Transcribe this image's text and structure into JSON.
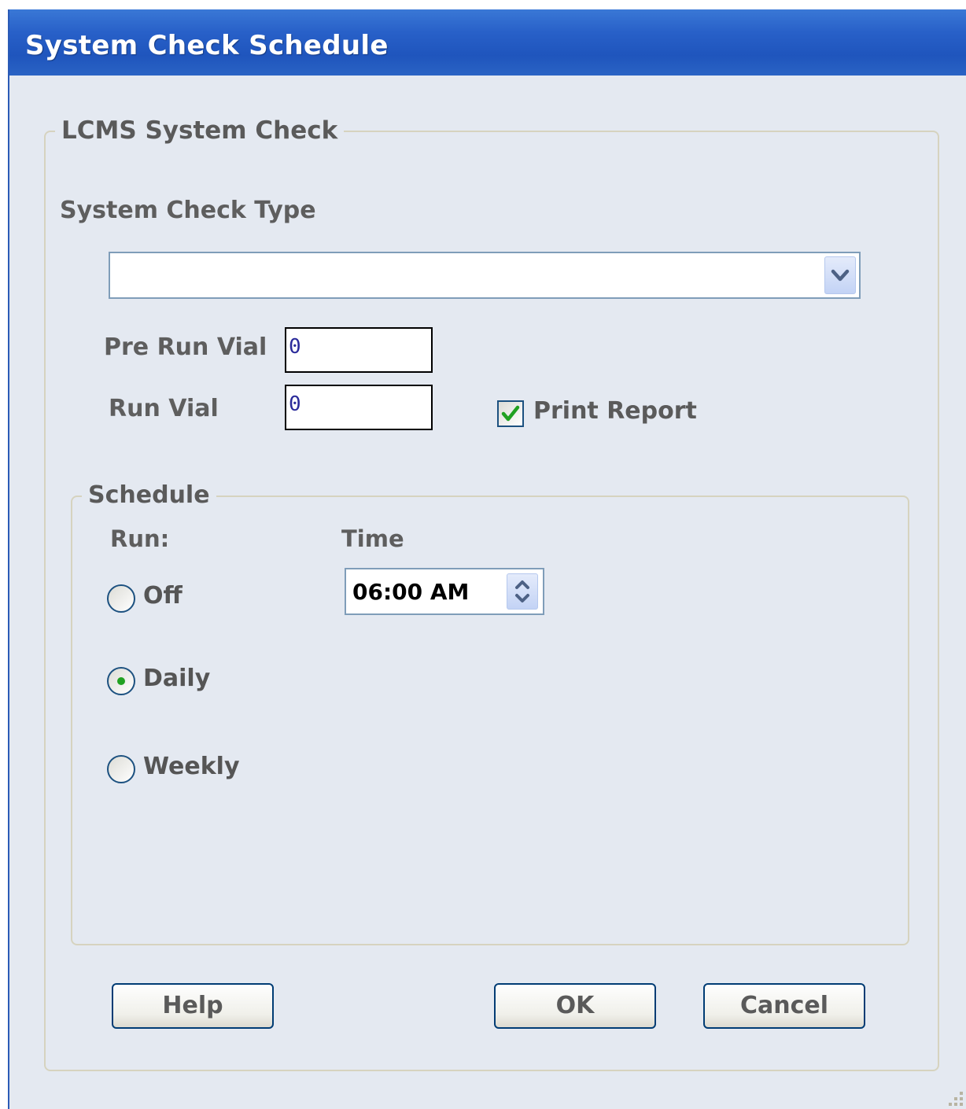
{
  "window": {
    "title": "System Check Schedule"
  },
  "lcms_group": {
    "legend": "LCMS System Check",
    "check_type_label": "System Check Type",
    "check_type_value": "",
    "pre_run_vial_label": "Pre Run Vial",
    "pre_run_vial_value": "0",
    "run_vial_label": "Run Vial",
    "run_vial_value": "0",
    "print_report_label": "Print Report",
    "print_report_checked": true
  },
  "schedule": {
    "legend": "Schedule",
    "run_label": "Run:",
    "time_label": "Time",
    "time_value": "06:00 AM",
    "options": [
      {
        "label": "Off",
        "selected": false
      },
      {
        "label": "Daily",
        "selected": true
      },
      {
        "label": "Weekly",
        "selected": false
      }
    ]
  },
  "buttons": {
    "help": "Help",
    "ok": "OK",
    "cancel": "Cancel"
  },
  "colors": {
    "titlebar": "#2860c8",
    "dialog_bg": "#e4e9f1",
    "group_border": "#d6d3bf",
    "check_mark": "#21a121",
    "radio_dot": "#21a121",
    "button_border": "#003c74"
  },
  "icons": {
    "combo_arrow": "chevron-down-icon",
    "check": "checkmark-icon",
    "spinner": "up-down-arrows-icon",
    "grip": "resize-grip-icon"
  }
}
